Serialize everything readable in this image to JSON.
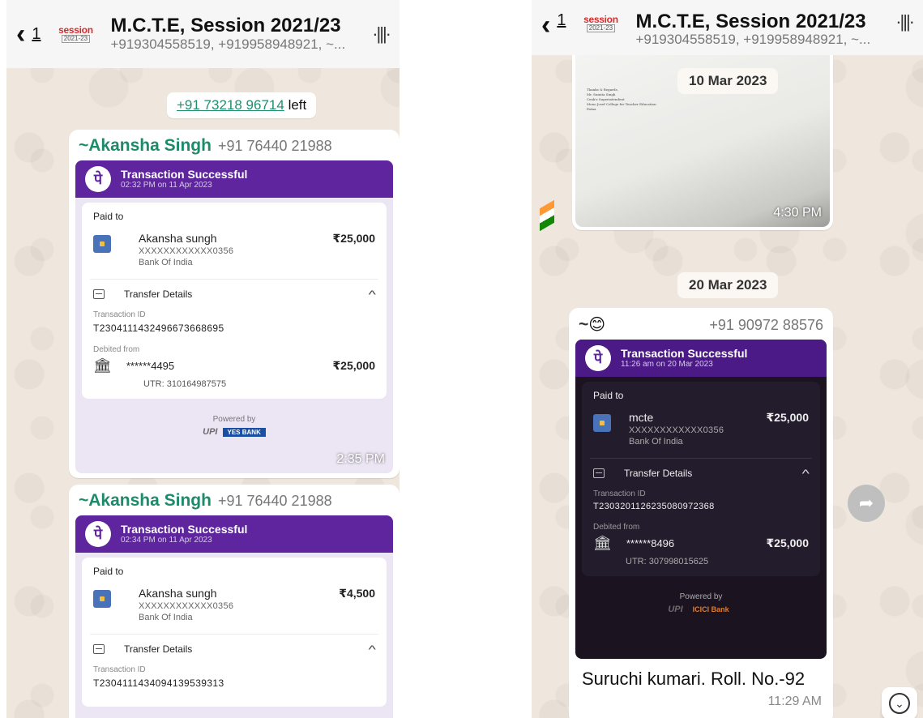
{
  "left": {
    "header": {
      "back_count": "1",
      "avatar_top": "session",
      "avatar_bottom": "2021-23",
      "title": "M.C.T.E, Session 2021/23",
      "subtitle": "+919304558519, +919958948921, ~..."
    },
    "system_message": {
      "number": "+91 73218 96714",
      "suffix": " left"
    },
    "messages": [
      {
        "sender": "~Akansha Singh",
        "phone": "+91 76440 21988",
        "receipt": {
          "title": "Transaction Successful",
          "subtitle": "02:32 PM on 11 Apr 2023",
          "paid_to": "Paid to",
          "payee": "Akansha sungh",
          "account": "XXXXXXXXXXXX0356",
          "bank": "Bank Of India",
          "amount": "₹25,000",
          "transfer_details": "Transfer Details",
          "txn_label": "Transaction ID",
          "txn_id": "T2304111432496673668695",
          "debited_label": "Debited from",
          "masked_account": "******4495",
          "debited_amount": "₹25,000",
          "utr": "UTR: 310164987575",
          "powered_by": "Powered by",
          "upi": "UPI",
          "bank_badge": "YES BANK"
        },
        "time": "2:35 PM"
      },
      {
        "sender": "~Akansha Singh",
        "phone": "+91 76440 21988",
        "receipt": {
          "title": "Transaction Successful",
          "subtitle": "02:34 PM on 11 Apr 2023",
          "paid_to": "Paid to",
          "payee": "Akansha sungh",
          "account": "XXXXXXXXXXXX0356",
          "bank": "Bank Of India",
          "amount": "₹4,500",
          "transfer_details": "Transfer Details",
          "txn_label": "Transaction ID",
          "txn_id": "T2304111434094139539313"
        }
      }
    ]
  },
  "right": {
    "header": {
      "back_count": "1",
      "avatar_top": "session",
      "avatar_bottom": "2021-23",
      "title": "M.C.T.E, Session 2021/23",
      "subtitle": "+919304558519, +919958948921, ~..."
    },
    "image_message": {
      "date": "10 Mar 2023",
      "photo_text": [
        "Thanks & Regards,",
        "Mr. Sumita Singh",
        "Cenk'z Superintendent",
        "Mono Josef College for Teacher Education",
        "Patna"
      ],
      "time": "4:30 PM"
    },
    "date_pill": "20 Mar 2023",
    "message": {
      "sender": "~",
      "emoji": "😊",
      "phone": "+91 90972 88576",
      "receipt": {
        "title": "Transaction Successful",
        "subtitle": "11:26 am on 20 Mar 2023",
        "paid_to": "Paid to",
        "payee": "mcte",
        "account": "XXXXXXXXXXXX0356",
        "bank": "Bank Of India",
        "amount": "₹25,000",
        "transfer_details": "Transfer Details",
        "txn_label": "Transaction ID",
        "txn_id": "T2303201126235080972368",
        "debited_label": "Debited from",
        "masked_account": "******8496",
        "debited_amount": "₹25,000",
        "utr": "UTR: 307998015625",
        "powered_by": "Powered by",
        "upi": "UPI",
        "bank_badge": "ICICI Bank"
      },
      "caption": "Suruchi kumari. Roll. No.-92",
      "time": "11:29 AM"
    }
  },
  "icons": {
    "back": "‹",
    "waveform": "·|||·",
    "forward": "➦",
    "scroll_down": "⌄",
    "bank": "🏛",
    "chevron_up": "^",
    "phonepe_logo": "पे"
  }
}
